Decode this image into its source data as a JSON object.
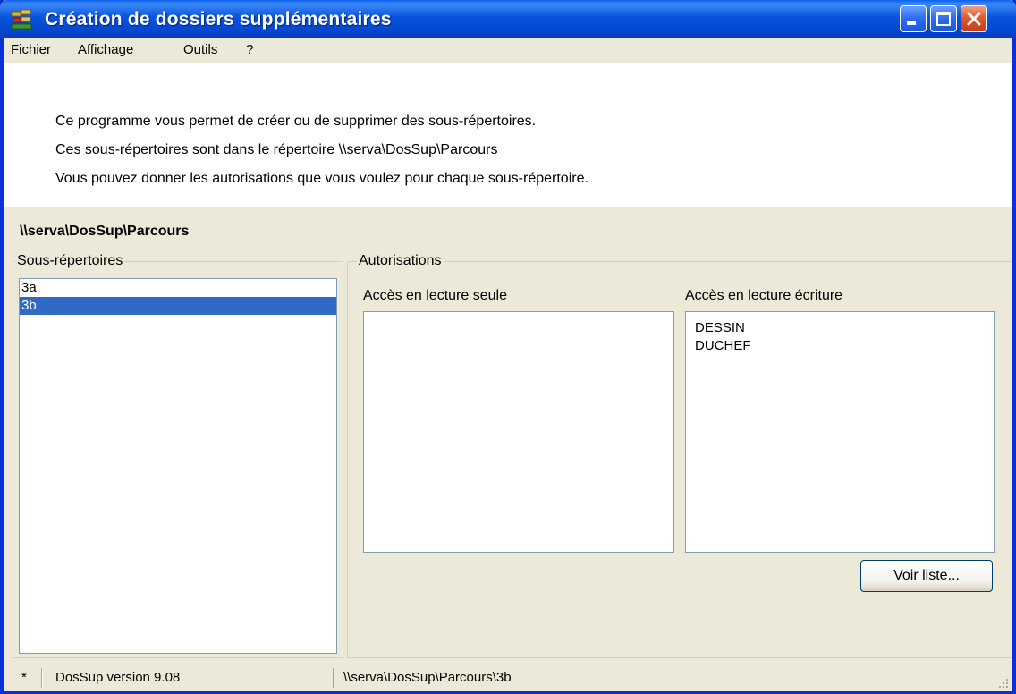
{
  "window": {
    "title": "Création de dossiers supplémentaires"
  },
  "menu": {
    "items": [
      {
        "label": "Fichier",
        "mnemonic": "F",
        "rest": "ichier"
      },
      {
        "label": "Affichage",
        "mnemonic": "A",
        "rest": "ffichage"
      },
      {
        "label": "Outils",
        "mnemonic": "O",
        "rest": "utils"
      },
      {
        "label": "?",
        "mnemonic": "?",
        "rest": ""
      }
    ]
  },
  "intro": {
    "lines": [
      "Ce programme vous permet de créer ou de supprimer des sous-répertoires.",
      "Ces sous-répertoires sont dans le répertoire \\\\serva\\DosSup\\Parcours",
      "Vous pouvez donner les autorisations que vous voulez pour chaque sous-répertoire."
    ]
  },
  "path_title": "\\\\serva\\DosSup\\Parcours",
  "subdirs": {
    "legend": "Sous-répertoires",
    "items": [
      "3a",
      "3b"
    ],
    "selected_index": 1
  },
  "permissions": {
    "legend": "Autorisations",
    "readonly_label": "Accès en lecture seule",
    "readonly_items": [],
    "readwrite_label": "Accès en lecture écriture",
    "readwrite_items": [
      "DESSIN",
      "DUCHEF"
    ],
    "view_list_button": "Voir liste..."
  },
  "status": {
    "marker": "*",
    "version": "DosSup version 9.08",
    "path": "\\\\serva\\DosSup\\Parcours\\3b"
  },
  "colors": {
    "titlebar": "#0855dd",
    "selection": "#316ac5",
    "face": "#ece9d8"
  }
}
